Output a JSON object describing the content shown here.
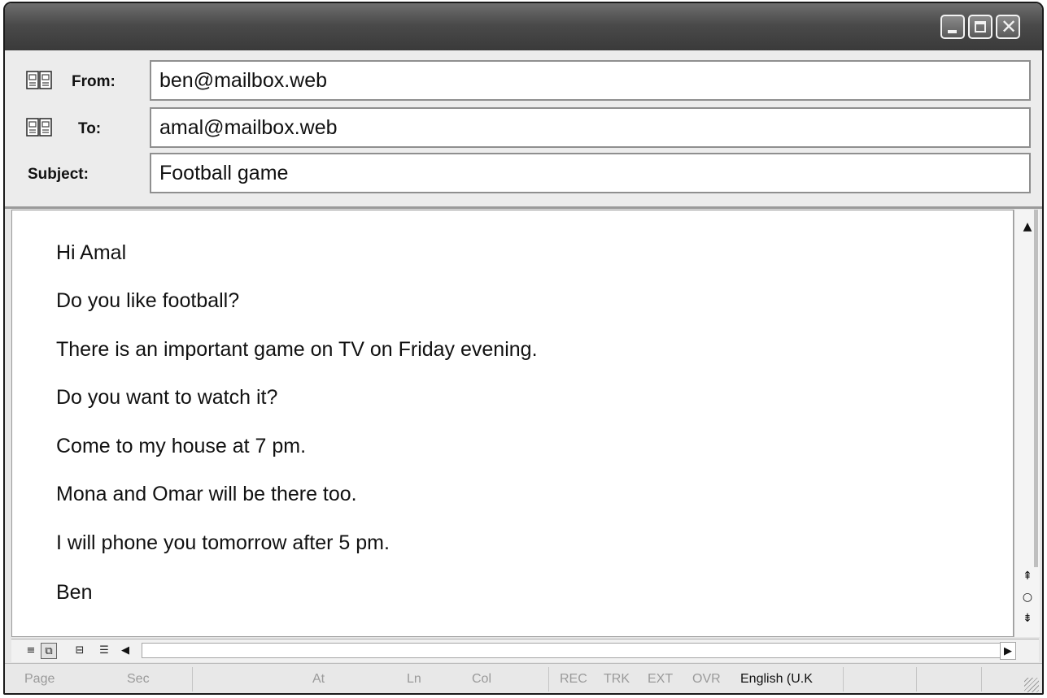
{
  "header": {
    "from_label": "From:",
    "from_value": "ben@mailbox.web",
    "to_label": "To:",
    "to_value": "amal@mailbox.web",
    "subject_label": "Subject:",
    "subject_value": "Football game"
  },
  "message": {
    "lines": [
      "Hi Amal",
      "Do you like football?",
      "There is an important game on TV on Friday evening.",
      "Do you want to watch it?",
      "Come to my house at 7 pm.",
      "Mona and Omar will be there too.",
      "I will phone you tomorrow after 5 pm.",
      "Ben"
    ]
  },
  "statusbar": {
    "page": "Page",
    "sec": "Sec",
    "at": "At",
    "ln": "Ln",
    "col": "Col",
    "rec": "REC",
    "trk": "TRK",
    "ext": "EXT",
    "ovr": "OVR",
    "language": "English (U.K"
  },
  "icons": {
    "address_book": "address-book-icon",
    "minimize": "minimize-icon",
    "maximize": "maximize-icon",
    "close": "close-icon"
  },
  "colors": {
    "titlebar": "#4a4a4a",
    "window_bg": "#e6e6e6",
    "field_border": "#8f8f8f",
    "status_disabled": "#9a9a9a"
  }
}
